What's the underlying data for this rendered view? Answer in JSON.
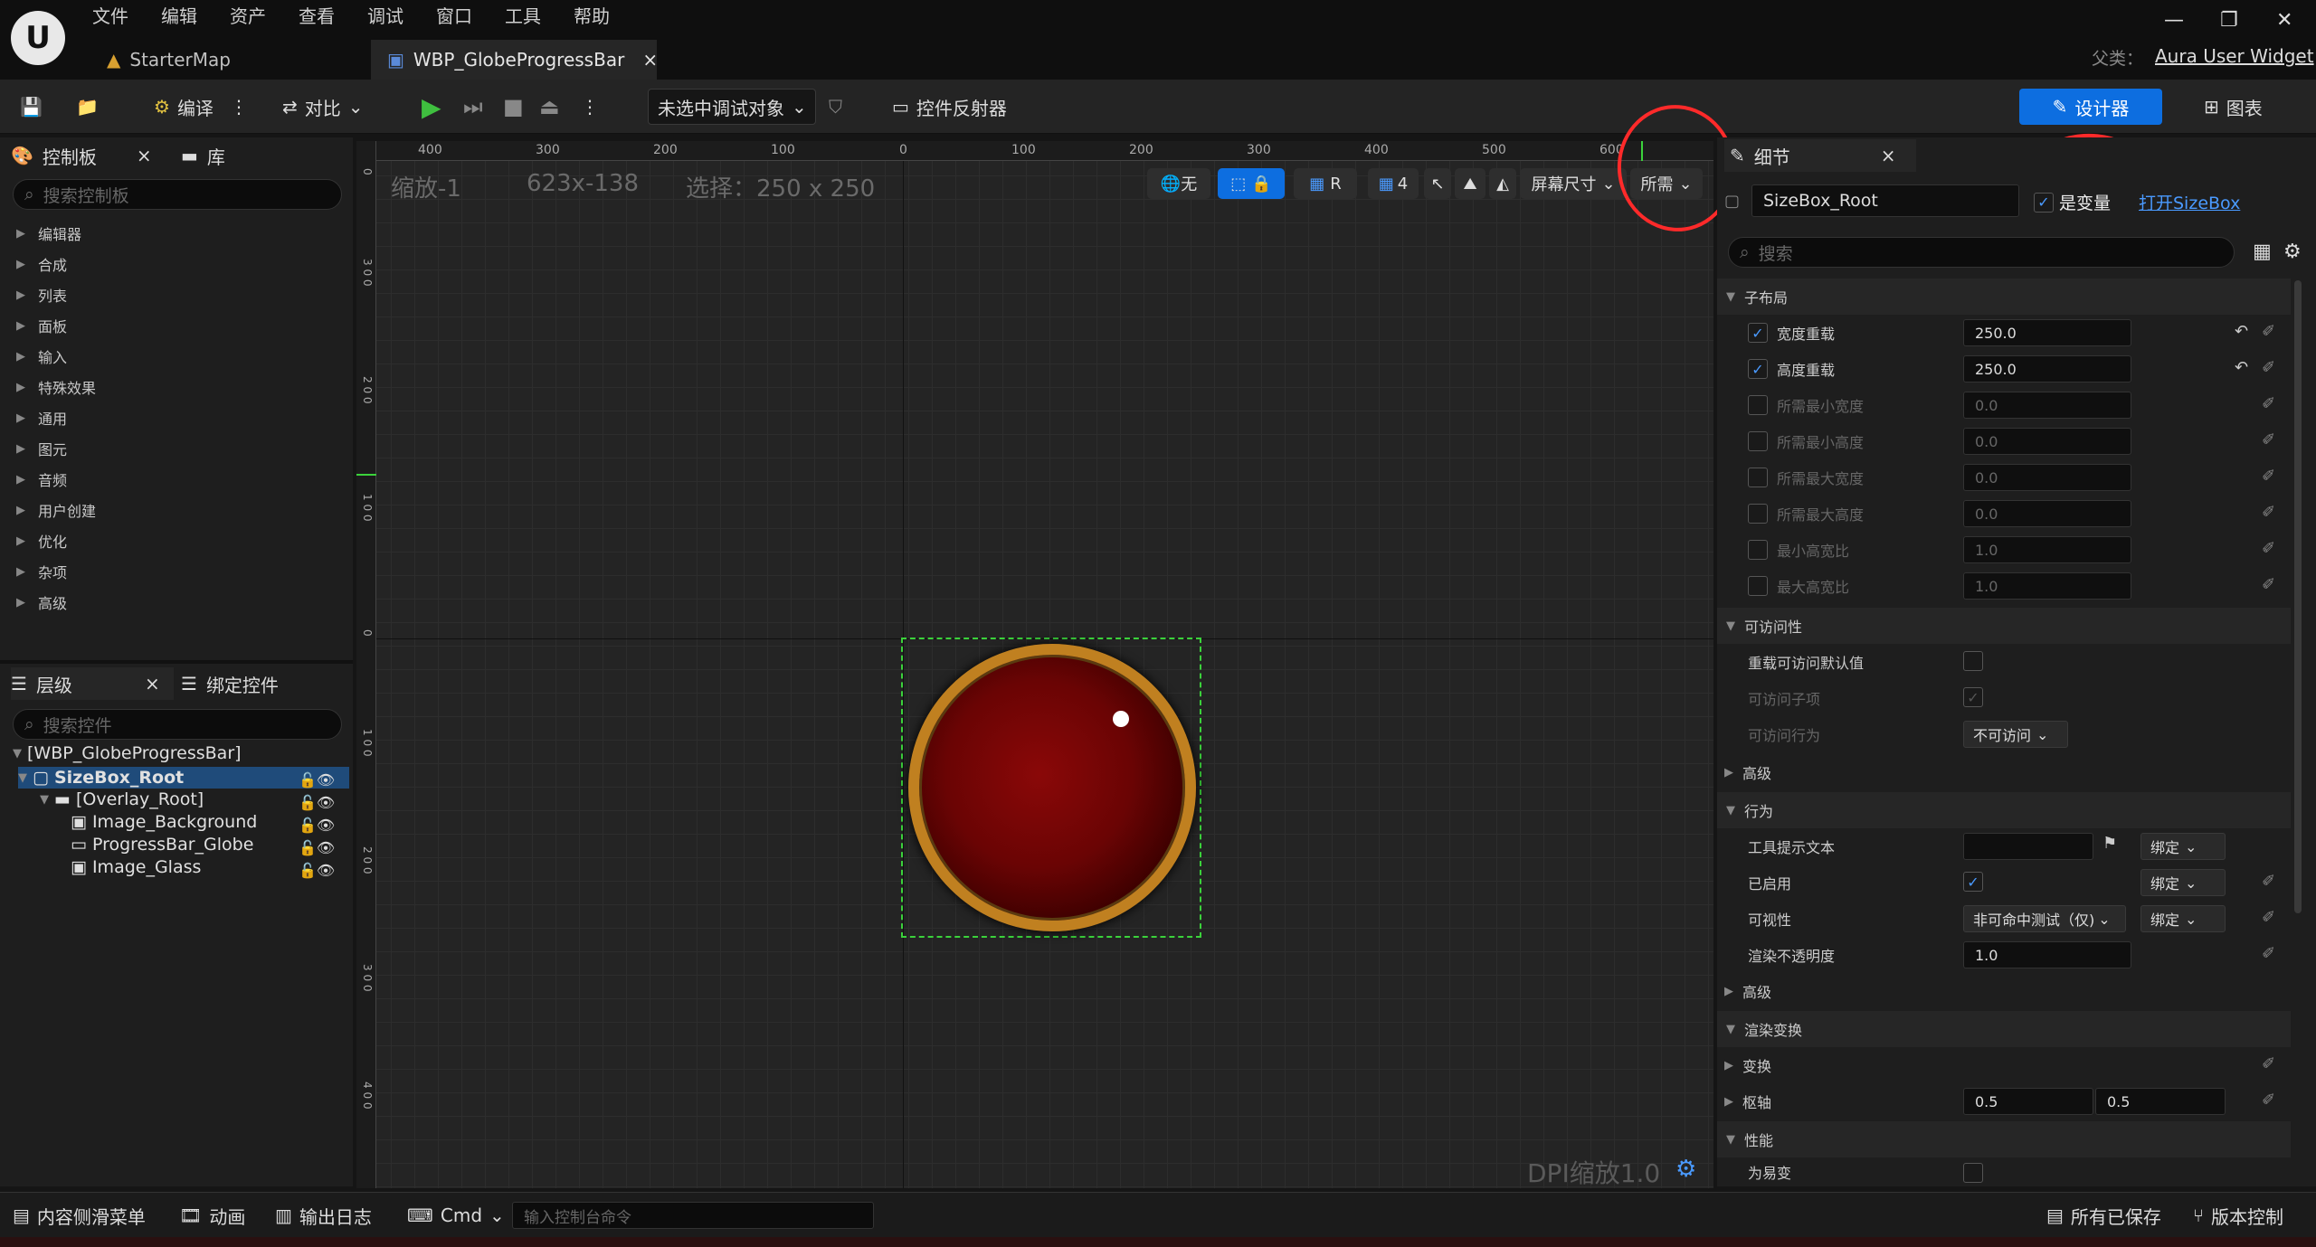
{
  "menu": [
    "文件",
    "编辑",
    "资产",
    "查看",
    "调试",
    "窗口",
    "工具",
    "帮助"
  ],
  "tabs": {
    "map": "StarterMap",
    "widget": "WBP_GlobeProgressBar"
  },
  "parent": {
    "label": "父类：",
    "value": "Aura User Widget"
  },
  "toolbar": {
    "compile": "编译",
    "diff": "对比",
    "debug": "未选中调试对象",
    "reflector": "控件反射器",
    "designer": "设计器",
    "graph": "图表"
  },
  "palette": {
    "tab": "控制板",
    "library": "库",
    "search_placeholder": "搜索控制板",
    "categories": [
      "编辑器",
      "合成",
      "列表",
      "面板",
      "输入",
      "特殊效果",
      "通用",
      "图元",
      "音频",
      "用户创建",
      "优化",
      "杂项",
      "高级"
    ]
  },
  "hierarchy": {
    "tab": "层级",
    "bind_tab": "绑定控件",
    "search_placeholder": "搜索控件",
    "root": "[WBP_GlobeProgressBar]",
    "sizebox": "SizeBox_Root",
    "overlay": "[Overlay_Root]",
    "children": [
      "Image_Background",
      "ProgressBar_Globe",
      "Image_Glass"
    ]
  },
  "canvas": {
    "zoom": "缩放-1",
    "size": "623x-138",
    "selection": "选择：250 x 250",
    "dpi": "DPI缩放1.0",
    "btn_none": "无",
    "btn_r": "R",
    "btn_4": "4",
    "screen_size": "屏幕尺寸",
    "desired": "所需",
    "ruler_h": [
      "400",
      "300",
      "200",
      "100",
      "0",
      "100",
      "200",
      "300",
      "400",
      "500",
      "600"
    ],
    "ruler_v": [
      "0",
      "3 0 0",
      "2 0 0",
      "1 0 0",
      "0",
      "1 0 0",
      "2 0 0",
      "3 0 0",
      "4 0 0"
    ]
  },
  "details": {
    "tab": "细节",
    "name": "SizeBox_Root",
    "is_variable": "是变量",
    "open": "打开SizeBox",
    "search_placeholder": "搜索",
    "sections": {
      "child_layout": "子布局",
      "accessibility": "可访问性",
      "advanced": "高级",
      "behavior": "行为",
      "render_transform": "渲染变换",
      "performance": "性能"
    },
    "child_layout": [
      {
        "label": "宽度重载",
        "value": "250.0",
        "checked": true
      },
      {
        "label": "高度重载",
        "value": "250.0",
        "checked": true
      },
      {
        "label": "所需最小宽度",
        "value": "0.0",
        "checked": false
      },
      {
        "label": "所需最小高度",
        "value": "0.0",
        "checked": false
      },
      {
        "label": "所需最大宽度",
        "value": "0.0",
        "checked": false
      },
      {
        "label": "所需最大高度",
        "value": "0.0",
        "checked": false
      },
      {
        "label": "最小高宽比",
        "value": "1.0",
        "checked": false
      },
      {
        "label": "最大高宽比",
        "value": "1.0",
        "checked": false
      }
    ],
    "override_access": "重载可访问默认值",
    "access_children": "可访问子项",
    "access_behavior": "可访问行为",
    "access_behavior_value": "不可访问",
    "tooltip": "工具提示文本",
    "enabled": "已启用",
    "visibility": "可视性",
    "visibility_value": "非可命中测试（仅)",
    "opacity": "渲染不透明度",
    "opacity_value": "1.0",
    "bind": "绑定",
    "transform": "变换",
    "pivot": "枢轴",
    "pivot_x": "0.5",
    "pivot_y": "0.5",
    "volatile": "为易变"
  },
  "status": {
    "drawer": "内容侧滑菜单",
    "anim": "动画",
    "log": "输出日志",
    "cmd": "Cmd",
    "cmd_placeholder": "输入控制台命令",
    "saved": "所有已保存",
    "source": "版本控制"
  }
}
